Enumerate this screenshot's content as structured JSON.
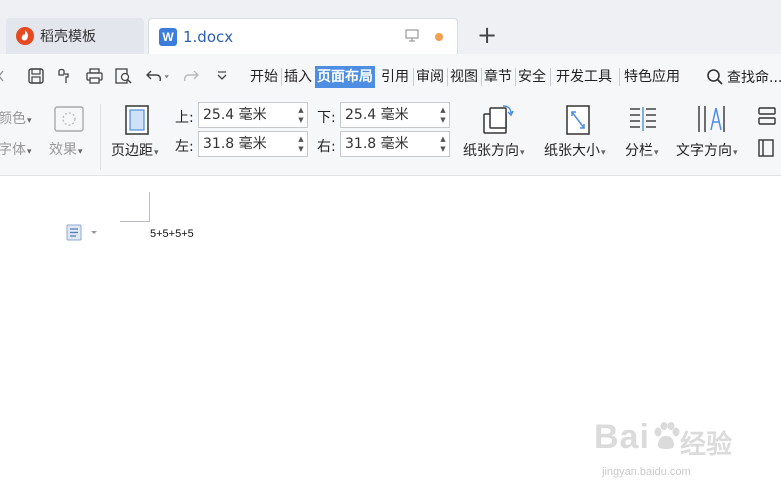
{
  "tabs": {
    "daoke": {
      "label": "稻壳模板"
    },
    "doc": {
      "label": "1.docx",
      "logo": "W"
    },
    "new_tab": "+"
  },
  "menu": {
    "items": [
      "开始",
      "插入",
      "页面布局",
      "引用",
      "审阅",
      "视图",
      "章节",
      "安全",
      "开发工具",
      "特色应用"
    ],
    "active": "页面布局",
    "search": "查找命..."
  },
  "ribbon": {
    "color_label": "颜色",
    "font_label": "字体",
    "effect_label": "效果",
    "margin_button": "页边距",
    "margins": {
      "top_label": "上:",
      "top_value": "25.4 毫米",
      "bottom_label": "下:",
      "bottom_value": "25.4 毫米",
      "left_label": "左:",
      "left_value": "31.8 毫米",
      "right_label": "右:",
      "right_value": "31.8 毫米"
    },
    "orientation": "纸张方向",
    "size": "纸张大小",
    "columns": "分栏",
    "text_direction": "文字方向"
  },
  "document": {
    "text": "5+5+5+5"
  },
  "watermark": {
    "brand": "Bai",
    "suffix": "经验",
    "url": "jingyan.baidu.com"
  },
  "colors": {
    "accent": "#4d8ee3",
    "doc_tab_text": "#2b5fb4",
    "modified_dot": "#f0a050",
    "app_logo": "#e8491e"
  }
}
